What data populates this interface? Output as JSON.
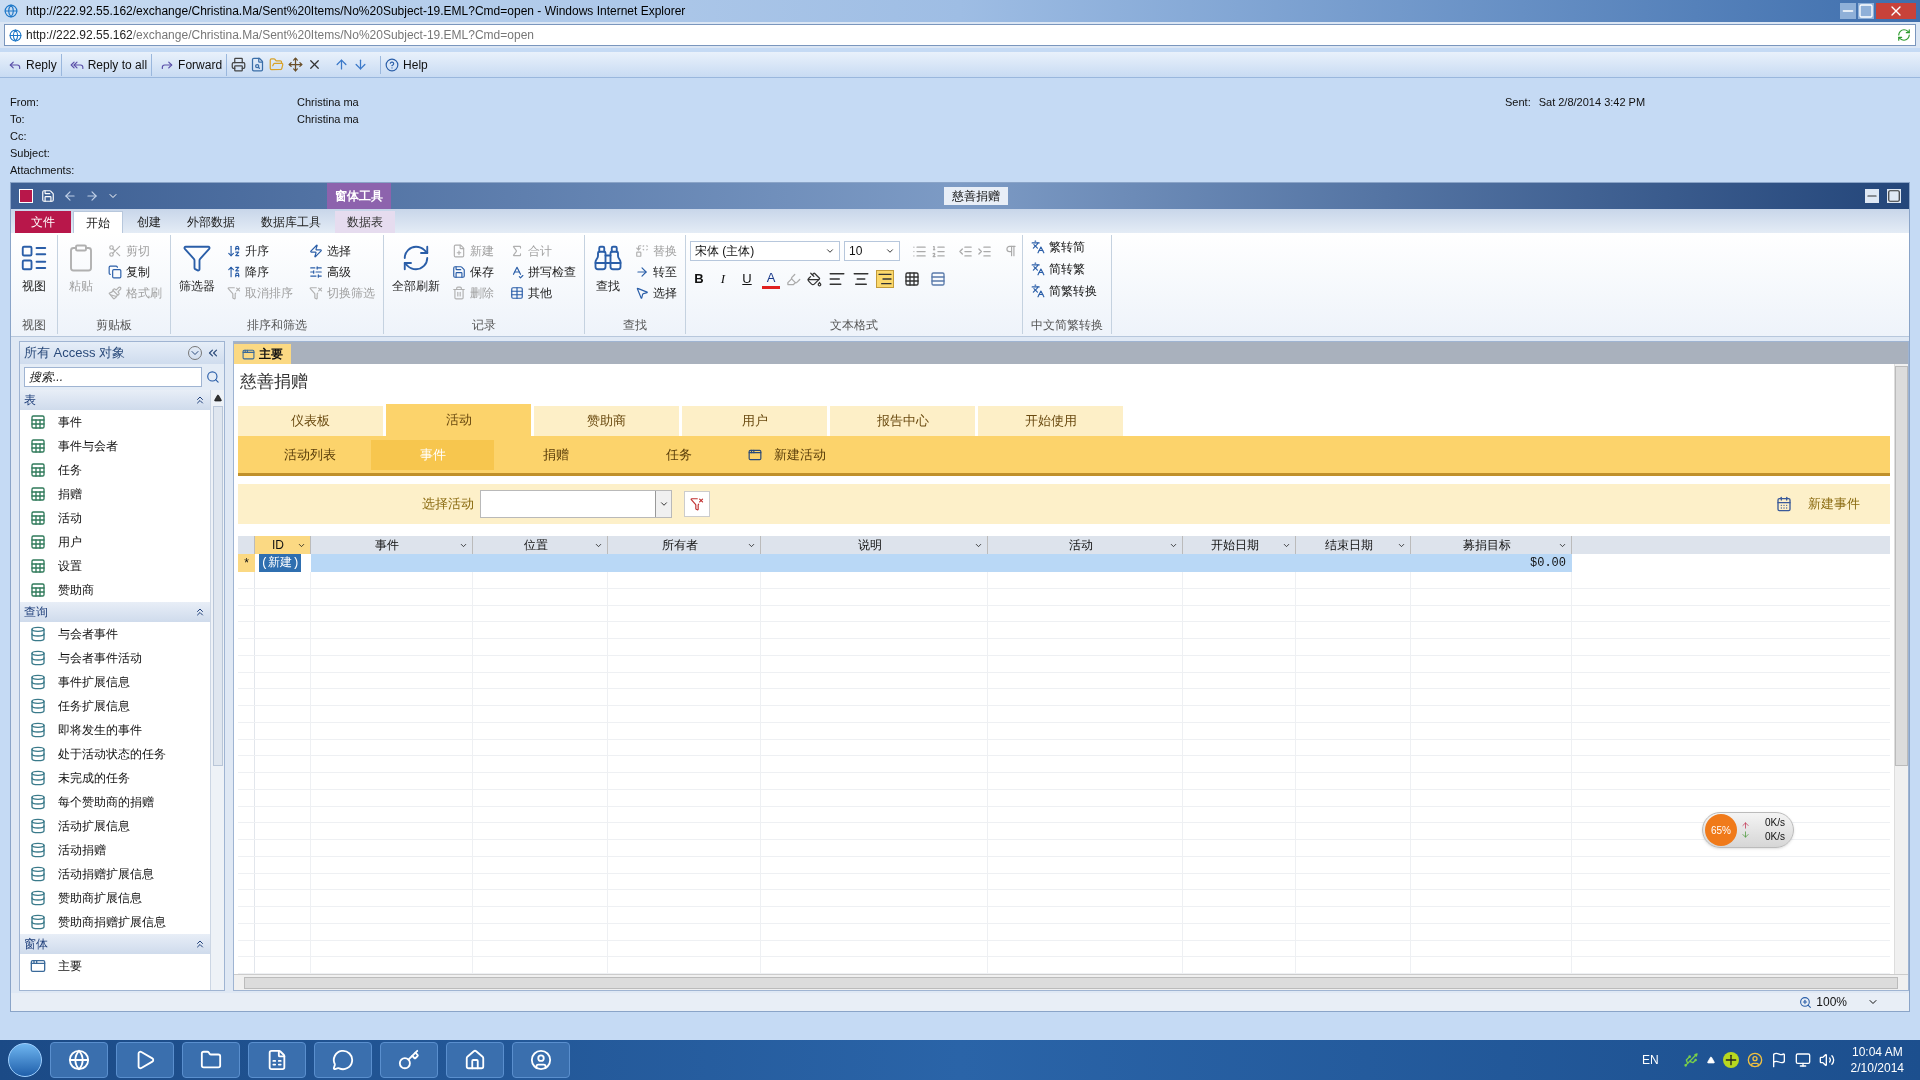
{
  "browser": {
    "title": "http://222.92.55.162/exchange/Christina.Ma/Sent%20Items/No%20Subject-19.EML?Cmd=open - Windows Internet Explorer",
    "address_host": "http://222.92.55.162",
    "address_path": "/exchange/Christina.Ma/Sent%20Items/No%20Subject-19.EML?Cmd=open"
  },
  "mail_toolbar": {
    "buttons": [
      "Reply",
      "Reply to all",
      "Forward"
    ],
    "help": "Help"
  },
  "mail_header": {
    "fields": [
      {
        "label": "From:",
        "value": "Christina ma"
      },
      {
        "label": "To:",
        "value": "Christina ma"
      },
      {
        "label": "Cc:"
      },
      {
        "label": "Subject:"
      },
      {
        "label": "Attachments:"
      }
    ],
    "sent_label": "Sent:",
    "sent_value": "Sat 2/8/2014 3:42 PM"
  },
  "access": {
    "title": "慈善捐赠",
    "context_tab": "窗体工具",
    "ribbon_tabs": [
      {
        "label": "文件",
        "kind": "file",
        "selected": false
      },
      {
        "label": "开始",
        "kind": "normal",
        "selected": true
      },
      {
        "label": "创建",
        "kind": "normal",
        "selected": false
      },
      {
        "label": "外部数据",
        "kind": "normal",
        "selected": false
      },
      {
        "label": "数据库工具",
        "kind": "normal",
        "selected": false
      },
      {
        "label": "数据表",
        "kind": "context",
        "selected": false
      }
    ],
    "ribbon_groups": [
      {
        "title": "视图",
        "items": [
          {
            "label": "视图",
            "kind": "large",
            "disabled": false
          }
        ]
      },
      {
        "title": "剪贴板",
        "items": [
          {
            "label": "粘贴",
            "kind": "large",
            "disabled": true
          },
          {
            "label": "剪切",
            "kind": "small",
            "disabled": true
          },
          {
            "label": "复制",
            "kind": "small",
            "disabled": false
          },
          {
            "label": "格式刷",
            "kind": "small",
            "disabled": true
          }
        ]
      },
      {
        "title": "排序和筛选",
        "items": [
          {
            "label": "筛选器",
            "kind": "large",
            "disabled": false
          },
          {
            "label": "升序",
            "kind": "small",
            "disabled": false
          },
          {
            "label": "降序",
            "kind": "small",
            "disabled": false
          },
          {
            "label": "取消排序",
            "kind": "small",
            "disabled": true
          },
          {
            "label": "选择",
            "kind": "small",
            "disabled": false
          },
          {
            "label": "高级",
            "kind": "small",
            "disabled": false
          },
          {
            "label": "切换筛选",
            "kind": "small",
            "disabled": true
          }
        ]
      },
      {
        "title": "记录",
        "items": [
          {
            "label": "全部刷新",
            "kind": "large",
            "disabled": false
          },
          {
            "label": "新建",
            "kind": "small",
            "disabled": true
          },
          {
            "label": "保存",
            "kind": "small",
            "disabled": false
          },
          {
            "label": "删除",
            "kind": "small",
            "disabled": true
          },
          {
            "label": "合计",
            "kind": "small",
            "disabled": true
          },
          {
            "label": "拼写检查",
            "kind": "small",
            "disabled": false
          },
          {
            "label": "其他",
            "kind": "small",
            "disabled": false
          }
        ]
      },
      {
        "title": "查找",
        "items": [
          {
            "label": "查找",
            "kind": "large",
            "disabled": false
          },
          {
            "label": "替换",
            "kind": "small",
            "disabled": true
          },
          {
            "label": "转至",
            "kind": "small",
            "disabled": false
          },
          {
            "label": "选择",
            "kind": "small",
            "disabled": false
          }
        ]
      }
    ],
    "text_format": {
      "title": "文本格式",
      "font": "宋体 (主体)",
      "size": "10",
      "styles": [
        {
          "label": "B",
          "kind": "bold"
        },
        {
          "label": "I",
          "kind": "italic"
        },
        {
          "label": "U",
          "kind": "underline"
        },
        {
          "label": "A",
          "kind": "color"
        }
      ],
      "align": [
        {
          "kind": "left",
          "selected": false
        },
        {
          "kind": "center",
          "selected": false
        },
        {
          "kind": "right",
          "selected": true
        }
      ]
    },
    "convert_group": {
      "title": "中文简繁转换",
      "items": [
        "繁转简",
        "简转繁",
        "简繁转换"
      ]
    },
    "nav": {
      "title": "所有 Access 对象",
      "search_placeholder": "搜索...",
      "groups": [
        {
          "title": "表",
          "kind": "table",
          "items": [
            "事件",
            "事件与会者",
            "任务",
            "捐赠",
            "活动",
            "用户",
            "设置",
            "赞助商"
          ]
        },
        {
          "title": "查询",
          "kind": "query",
          "items": [
            "与会者事件",
            "与会者事件活动",
            "事件扩展信息",
            "任务扩展信息",
            "即将发生的事件",
            "处于活动状态的任务",
            "未完成的任务",
            "每个赞助商的捐赠",
            "活动扩展信息",
            "活动捐赠",
            "活动捐赠扩展信息",
            "赞助商扩展信息",
            "赞助商捐赠扩展信息"
          ]
        },
        {
          "title": "窗体",
          "kind": "form",
          "items": [
            "主要"
          ]
        }
      ]
    },
    "document_tab": "主要",
    "form_title": "慈善捐赠",
    "main_tabs": [
      {
        "label": "仪表板",
        "selected": false
      },
      {
        "label": "活动",
        "selected": true
      },
      {
        "label": "赞助商",
        "selected": false
      },
      {
        "label": "用户",
        "selected": false
      },
      {
        "label": "报告中心",
        "selected": false
      },
      {
        "label": "开始使用",
        "selected": false
      }
    ],
    "sub_tabs": [
      {
        "label": "活动列表",
        "kind": "tab",
        "selected": false
      },
      {
        "label": "事件",
        "kind": "tab",
        "selected": true
      },
      {
        "label": "捐赠",
        "kind": "tab",
        "selected": false
      },
      {
        "label": "任务",
        "kind": "tab",
        "selected": false
      },
      {
        "label": "新建活动",
        "kind": "action"
      }
    ],
    "filter": {
      "label": "选择活动",
      "new_button": "新建事件"
    },
    "datasheet": {
      "columns": [
        "ID",
        "事件",
        "位置",
        "所有者",
        "说明",
        "活动",
        "开始日期",
        "结束日期",
        "募捐目标"
      ],
      "new_row": {
        "marker": "*",
        "id": "(新建)",
        "goal": "$0.00"
      }
    },
    "zoom": "100%"
  },
  "net_widget": {
    "percent": "65%",
    "up": "0K/s",
    "down": "0K/s"
  },
  "taskbar": {
    "language": "EN",
    "time": "10:04 AM",
    "date": "2/10/2014"
  }
}
